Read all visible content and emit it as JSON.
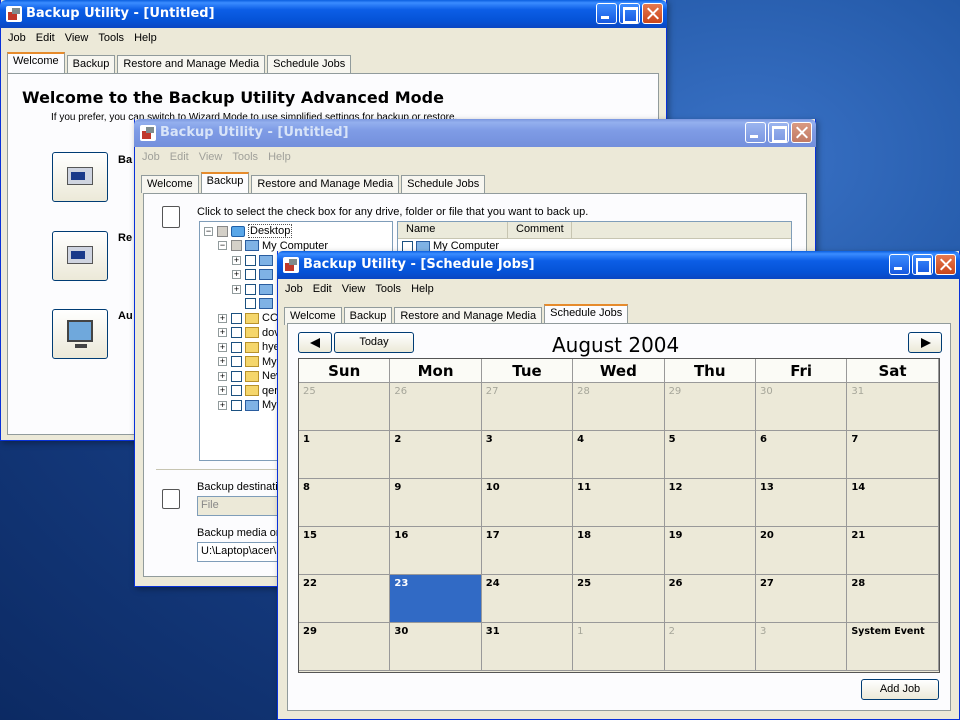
{
  "colors": {
    "title_active": "#0552d6",
    "title_inactive": "#7f9ce6",
    "tab_accent": "#e68b2c",
    "today_highlight": "#316ac5",
    "window_bg": "#ece9d8"
  },
  "menu": [
    "Job",
    "Edit",
    "View",
    "Tools",
    "Help"
  ],
  "tabs": [
    "Welcome",
    "Backup",
    "Restore and Manage Media",
    "Schedule Jobs"
  ],
  "win1": {
    "title": "Backup Utility - [Untitled]",
    "heading": "Welcome to the Backup Utility Advanced Mode",
    "intro": "If you prefer, you can switch to Wizard Mode to use simplified settings for backup or restore.",
    "buttons": [
      {
        "icon": "backup-wizard-icon",
        "label": "Ba"
      },
      {
        "icon": "restore-wizard-icon",
        "label": "Re"
      },
      {
        "icon": "asr-wizard-icon",
        "label": "Au"
      }
    ]
  },
  "win2": {
    "title": "Backup Utility - [Untitled]",
    "instruction": "Click to select the check box for any drive, folder or file that you want to back up.",
    "tree": [
      {
        "depth": 0,
        "expander": "−",
        "icon": "desktop-icon",
        "label": "Desktop",
        "selected": true
      },
      {
        "depth": 1,
        "expander": "−",
        "icon": "my-computer-icon",
        "label": "My Computer"
      },
      {
        "depth": 2,
        "expander": "+",
        "icon": "drive-icon",
        "label": ""
      },
      {
        "depth": 2,
        "expander": "+",
        "icon": "drive-icon",
        "label": ""
      },
      {
        "depth": 2,
        "expander": "+",
        "icon": "drive-icon",
        "label": ""
      },
      {
        "depth": 2,
        "expander": "",
        "icon": "drive-icon",
        "label": ""
      },
      {
        "depth": 1,
        "expander": "+",
        "icon": "folder-icon",
        "label": "CC"
      },
      {
        "depth": 1,
        "expander": "+",
        "icon": "folder-icon",
        "label": "dov"
      },
      {
        "depth": 1,
        "expander": "+",
        "icon": "folder-icon",
        "label": "hye"
      },
      {
        "depth": 1,
        "expander": "+",
        "icon": "folder-icon",
        "label": "My"
      },
      {
        "depth": 1,
        "expander": "+",
        "icon": "folder-icon",
        "label": "Nev"
      },
      {
        "depth": 1,
        "expander": "+",
        "icon": "folder-icon",
        "label": "qer"
      },
      {
        "depth": 1,
        "expander": "+",
        "icon": "network-icon",
        "label": "My"
      }
    ],
    "list_columns": [
      "Name",
      "Comment"
    ],
    "list_rows": [
      "My Computer"
    ],
    "dest_label": "Backup destinati",
    "dest_value": "File",
    "media_label": "Backup media or",
    "media_value": "U:\\Laptop\\acer\\"
  },
  "win3": {
    "title": "Backup Utility - [Schedule Jobs]",
    "today_label": "Today",
    "month_title": "August 2004",
    "weekdays": [
      "Sun",
      "Mon",
      "Tue",
      "Wed",
      "Thu",
      "Fri",
      "Sat"
    ],
    "days": [
      {
        "label": "25",
        "other": true
      },
      {
        "label": "26",
        "other": true
      },
      {
        "label": "27",
        "other": true
      },
      {
        "label": "28",
        "other": true
      },
      {
        "label": "29",
        "other": true
      },
      {
        "label": "30",
        "other": true
      },
      {
        "label": "31",
        "other": true
      },
      {
        "label": "1"
      },
      {
        "label": "2"
      },
      {
        "label": "3"
      },
      {
        "label": "4"
      },
      {
        "label": "5"
      },
      {
        "label": "6"
      },
      {
        "label": "7"
      },
      {
        "label": "8"
      },
      {
        "label": "9"
      },
      {
        "label": "10"
      },
      {
        "label": "11"
      },
      {
        "label": "12"
      },
      {
        "label": "13"
      },
      {
        "label": "14"
      },
      {
        "label": "15"
      },
      {
        "label": "16"
      },
      {
        "label": "17"
      },
      {
        "label": "18"
      },
      {
        "label": "19"
      },
      {
        "label": "20"
      },
      {
        "label": "21"
      },
      {
        "label": "22"
      },
      {
        "label": "23",
        "today": true
      },
      {
        "label": "24"
      },
      {
        "label": "25"
      },
      {
        "label": "26"
      },
      {
        "label": "27"
      },
      {
        "label": "28"
      },
      {
        "label": "29"
      },
      {
        "label": "30"
      },
      {
        "label": "31"
      },
      {
        "label": "1",
        "other": true
      },
      {
        "label": "2",
        "other": true
      },
      {
        "label": "3",
        "other": true
      },
      {
        "label": "",
        "event": "System Event"
      }
    ],
    "add_job_label": "Add Job"
  }
}
